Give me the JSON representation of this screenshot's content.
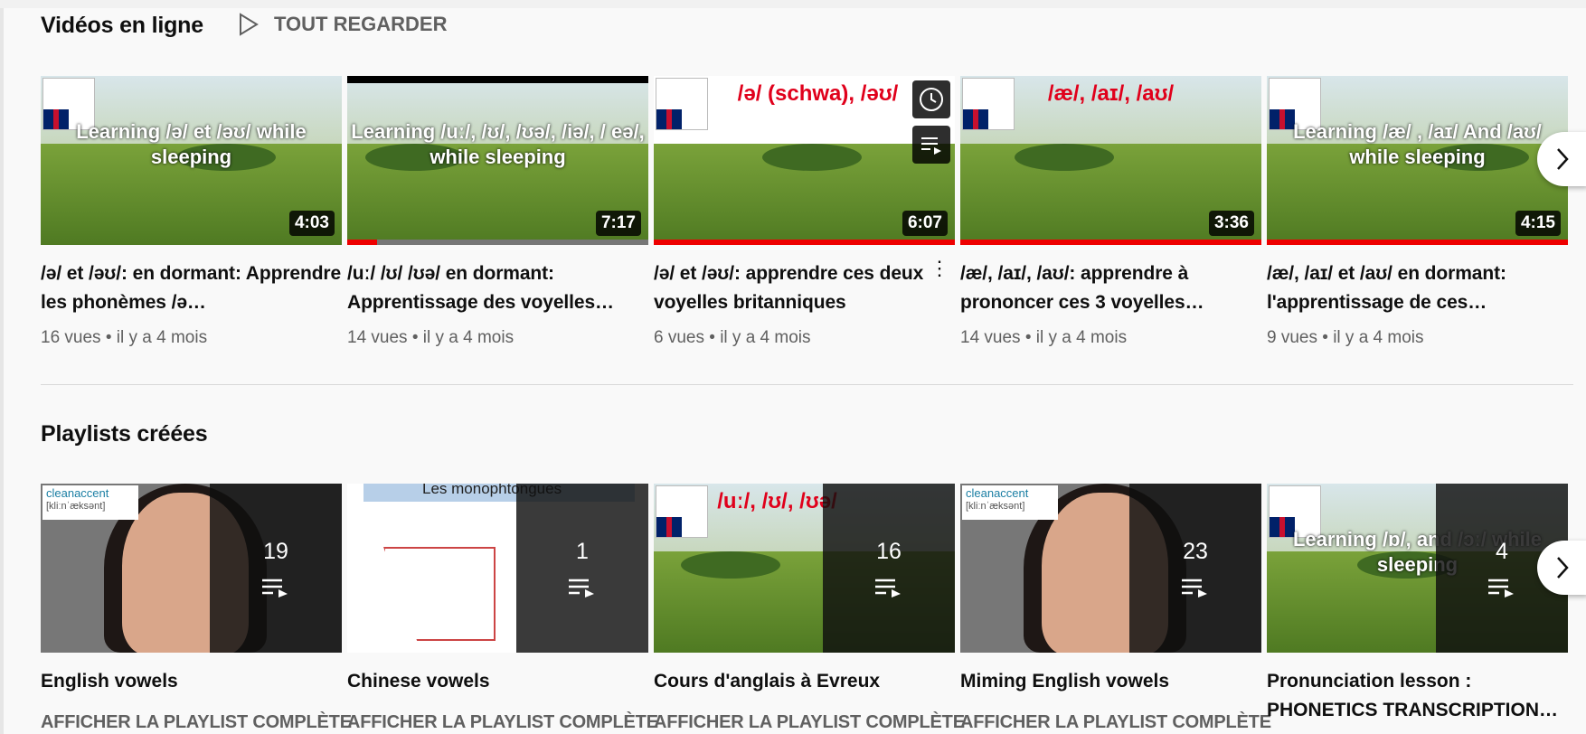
{
  "videos_section": {
    "title": "Vidéos en ligne",
    "play_all": "TOUT REGARDER",
    "items": [
      {
        "thumb_text": "Learning /ə/ et /əʊ/ while sleeping",
        "thumb_red": "",
        "duration": "4:03",
        "title": "/ə/ et /əʊ/: en dormant: Apprendre les phonèmes /ə…",
        "meta": "16 vues • il y a 4 mois",
        "progress": "none"
      },
      {
        "thumb_text": "Learning /uː/, /ʊ/, /ʊə/, /iə/, / eə/, while sleeping",
        "thumb_red": "",
        "duration": "7:17",
        "title": "/uː/ /ʊ/ /ʊə/ en dormant: Apprentissage des voyelles…",
        "meta": "14 vues • il y a 4 mois",
        "progress": "partial"
      },
      {
        "thumb_text": "",
        "thumb_red": "/ə/ (schwa), /əʊ/",
        "duration": "6:07",
        "title": "/ə/ et /əʊ/: apprendre ces deux voyelles britanniques",
        "meta": "6 vues • il y a 4 mois",
        "progress": "full"
      },
      {
        "thumb_text": "",
        "thumb_red": "/æ/, /aɪ/, /aʊ/",
        "duration": "3:36",
        "title": "/æ/, /aɪ/, /aʊ/: apprendre à prononcer ces 3 voyelles…",
        "meta": "14 vues • il y a 4 mois",
        "progress": "full"
      },
      {
        "thumb_text": "Learning /æ/ , /aɪ/ And /aʊ/ while sleeping",
        "thumb_red": "",
        "duration": "4:15",
        "title": "/æ/, /aɪ/ et /aʊ/ en dormant: l'apprentissage de ces…",
        "meta": "9 vues • il y a 4 mois",
        "progress": "full"
      }
    ]
  },
  "playlists_section": {
    "title": "Playlists créées",
    "items": [
      {
        "count": "19",
        "title": "English vowels",
        "link": "AFFICHER LA PLAYLIST COMPLÈTE",
        "logo": "cleanaccent",
        "logo_sub": "[kliːnˈæksənt]",
        "thumb_text": ""
      },
      {
        "count": "1",
        "title": "Chinese vowels",
        "link": "AFFICHER LA PLAYLIST COMPLÈTE",
        "logo": "",
        "logo_sub": "",
        "thumb_text": "Les monophtongues"
      },
      {
        "count": "16",
        "title": "Cours d'anglais à Evreux",
        "link": "AFFICHER LA PLAYLIST COMPLÈTE",
        "logo": "",
        "logo_sub": "",
        "thumb_text": "/uː/, /ʊ/, /ʊə/"
      },
      {
        "count": "23",
        "title": "Miming English vowels",
        "link": "AFFICHER LA PLAYLIST COMPLÈTE",
        "logo": "cleanaccent",
        "logo_sub": "[kliːnˈæksənt]",
        "thumb_text": ""
      },
      {
        "count": "4",
        "title": "Pronunciation lesson : PHONETICS TRANSCRIPTION…",
        "link": "",
        "logo": "",
        "logo_sub": "",
        "thumb_text": "Learning /ɒ/, and /ɔː/ while sleeping"
      }
    ]
  },
  "icons": {
    "play_all": "play-outline-icon",
    "next": "chevron-right-icon",
    "watch_later": "clock-icon",
    "add_queue": "queue-icon",
    "playlist": "playlist-play-icon",
    "more": "kebab-menu-icon"
  },
  "colors": {
    "accent_red": "#e00000",
    "meta_grey": "#606060"
  }
}
